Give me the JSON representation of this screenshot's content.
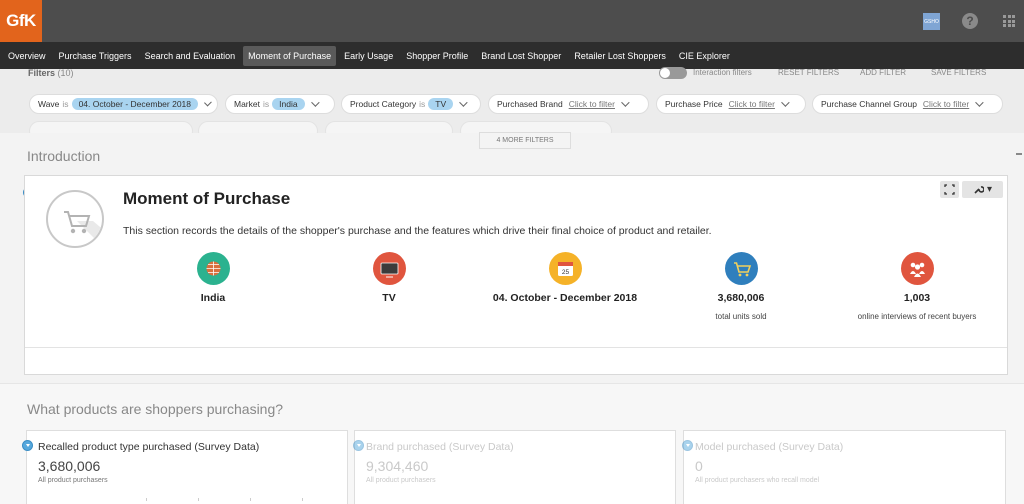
{
  "topbar": {
    "logo": "GfK",
    "user_badge": "GSHO",
    "help": "?"
  },
  "nav": [
    "Overview",
    "Purchase Triggers",
    "Search and Evaluation",
    "Moment of Purchase",
    "Early Usage",
    "Shopper Profile",
    "Brand Lost Shopper",
    "Retailer Lost Shoppers",
    "CIE Explorer"
  ],
  "nav_active": "Moment of Purchase",
  "filters": {
    "title": "Filters",
    "count": "(10)",
    "toggle_label": "Interaction filters",
    "reset": "RESET FILTERS",
    "add": "ADD FILTER",
    "save": "SAVE FILTERS",
    "is_word": "is",
    "click_text": "Click to filter",
    "wave": {
      "name": "Wave",
      "value": "04. October - December 2018"
    },
    "market": {
      "name": "Market",
      "value": "India"
    },
    "category": {
      "name": "Product Category",
      "value": "TV"
    },
    "brand": {
      "name": "Purchased Brand"
    },
    "price": {
      "name": "Purchase Price"
    },
    "channel": {
      "name": "Purchase Channel Group"
    },
    "more": "4 MORE FILTERS"
  },
  "intro": {
    "section_title": "Introduction",
    "card_title": "Moment of Purchase",
    "card_desc": "This section records the details of the shopper's purchase and the features which drive their final choice of product and retailer.",
    "tools": "▾",
    "stats": [
      {
        "icon": "globe-icon",
        "value": "India",
        "label": "",
        "color": "#2bb28f"
      },
      {
        "icon": "tv-icon",
        "value": "TV",
        "label": "",
        "color": "#e0553e"
      },
      {
        "icon": "calendar-icon",
        "value": "04. October - December 2018",
        "label": "",
        "color": "#f5b228",
        "day": "25"
      },
      {
        "icon": "cart-icon",
        "value": "3,680,006",
        "label": "total units sold",
        "color": "#2f7fbd"
      },
      {
        "icon": "people-icon",
        "value": "1,003",
        "label": "online interviews of recent buyers",
        "color": "#e0553e"
      }
    ]
  },
  "products": {
    "section_title": "What products are shoppers purchasing?",
    "cards": [
      {
        "title": "Recalled product type purchased (Survey Data)",
        "value": "3,680,006",
        "sub": "All product purchasers"
      },
      {
        "title": "Brand purchased (Survey Data)",
        "value": "9,304,460",
        "sub": "All product purchasers"
      },
      {
        "title": "Model purchased (Survey Data)",
        "value": "0",
        "sub": "All product purchasers who recall model"
      }
    ]
  },
  "colors": {
    "accent": "#e2641c",
    "topbar": "#4d4d4d",
    "nav": "#2d2d2d",
    "chip_value": "#a9d4f0",
    "marker": "#56a8dd"
  }
}
